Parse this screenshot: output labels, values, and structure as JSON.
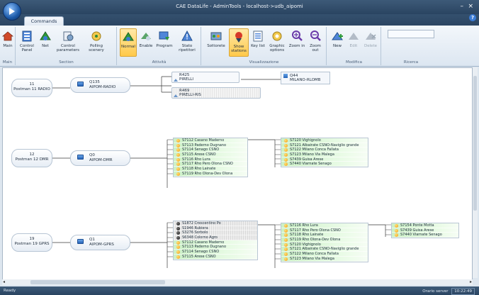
{
  "window": {
    "title": "CAE DataLife - AdminTools - localhost->udb_aipomi",
    "minimize": "–",
    "close": "×",
    "help": "?"
  },
  "tabs": [
    {
      "label": "Commands"
    }
  ],
  "ribbon": {
    "groups": {
      "main": "Main",
      "section": "Section",
      "attivita": "Attività",
      "visualizzazione": "Visualizzazione",
      "modifica": "Modifica",
      "ricerca": "Ricerca"
    },
    "buttons": {
      "main": "Main",
      "control_panel": "Control Panel",
      "net": "Net",
      "control_parameters": "Control parameters",
      "polling_scenery": "Polling scenery",
      "normal": "Normal",
      "enable": "Enable",
      "program": "Program",
      "stato_ripetitori": "Stato ripetitori",
      "sottorete": "Sottorete",
      "show_stations": "Show stations",
      "key_list": "Key list",
      "graphic_options": "Graphic options",
      "zoom_in": "Zoom in",
      "zoom_out": "Zoom out",
      "new": "New",
      "edit": "Edit",
      "delete": "Delete"
    }
  },
  "tree": {
    "groups": [
      {
        "postman_id": "11",
        "postman_label": "Postman 11 RADIO",
        "aipom_id": "Q135",
        "aipom_label": "AIPOM-RADIO",
        "pirelli": [
          {
            "id": "R425",
            "label": "PIRELLI"
          },
          {
            "id": "R469",
            "label": "PIRELLI-RIS"
          }
        ],
        "milano": {
          "id": "Q44",
          "label": "MILANO-RLOMB"
        }
      },
      {
        "postman_id": "12",
        "postman_label": "Postman 12 DMR",
        "aipom_id": "Q0",
        "aipom_label": "AIPOM-DMR",
        "col1": [
          "S7112 Casano Maderno",
          "S7113 Paderno Dugnano",
          "S7114 Senago CSNO",
          "S7115 Arese CSNO",
          "S7116 Rho Lura",
          "S7117 Rho Pero Olona CSNO",
          "S7118 Rho Lainate",
          "S7119 Rho Olona-Dev Olona"
        ],
        "col2": [
          "S7120 Vighignolo",
          "S7121 Albairate CSNO-Naviglio grande",
          "S7122 Milano Conca Fallata",
          "S7123 Milano Via Malega",
          "S7439 Guisa Arese",
          "S7440 Viarnate Senago"
        ]
      },
      {
        "postman_id": "19",
        "postman_label": "Postman 19 GPRS",
        "aipom_id": "Q1",
        "aipom_label": "AIPOM-GPRS",
        "col1_gray": [
          "S1872 Crescentino Po",
          "S1946 Rubiera",
          "S3276 Sorbolo",
          "S6348 Colorno Agro"
        ],
        "col1": [
          "S7112 Casano Maderno",
          "S7113 Paderno Dugnano",
          "S7114 Senago CSNO",
          "S7115 Arese CSNO"
        ],
        "col2": [
          "S7116 Rho Lura",
          "S7117 Rho Pero Olona CSNO",
          "S7118 Rho Lainate",
          "S7119 Rho Olona-Dev Olona",
          "S7120 Vighignolo",
          "S7121 Albairate CSNO-Naviglio grande",
          "S7122 Milano Conca Fallata",
          "S7123 Milano Via Malega"
        ],
        "col3": [
          "S7154 Ponte Motta",
          "S7439 Guisa Arese",
          "S7440 Viarnate Senago"
        ]
      }
    ]
  },
  "statusbar": {
    "status": "Ready",
    "user_label": "Orario server",
    "clock": "10:22:49"
  }
}
